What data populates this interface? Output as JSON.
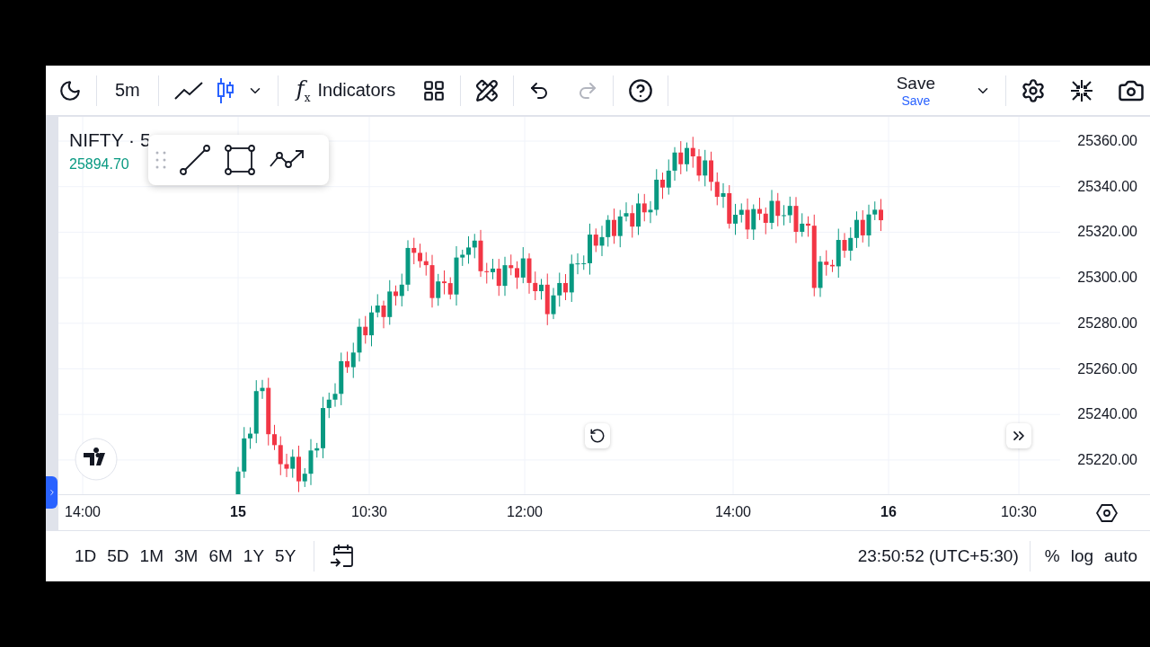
{
  "toolbar": {
    "interval": "5m",
    "chart_types": [
      {
        "kind": "line",
        "selected": false
      },
      {
        "kind": "candles",
        "selected": true
      }
    ],
    "indicators": {
      "icon": "f$_{x}$",
      "label": "Indicators"
    },
    "history": [
      {
        "kind": "undo",
        "disabled": false
      },
      {
        "kind": "redo",
        "disabled": true
      }
    ],
    "save": {
      "title": "Save",
      "subtitle": "Save"
    }
  },
  "legend": {
    "symbol": "NIFTY · 5",
    "price": "25894.70"
  },
  "price_axis": [
    "25360.00",
    "25340.00",
    "25320.00",
    "25300.00",
    "25280.00",
    "25260.00",
    "25240.00",
    "25220.00"
  ],
  "time_axis": [
    {
      "label": "14:00",
      "kind": "time"
    },
    {
      "label": "15",
      "kind": "day"
    },
    {
      "label": "10:30",
      "kind": "time"
    },
    {
      "label": "12:00",
      "kind": "time"
    },
    {
      "label": "14:00",
      "kind": "time"
    },
    {
      "label": "16",
      "kind": "day"
    },
    {
      "label": "10:30",
      "kind": "time"
    }
  ],
  "bottom_bar": {
    "ranges": [
      "1D",
      "5D",
      "1M",
      "3M",
      "6M",
      "1Y",
      "5Y"
    ],
    "clock": "23:50:52 (UTC+5:30)",
    "scale_options": [
      "%",
      "log",
      "auto"
    ]
  }
}
